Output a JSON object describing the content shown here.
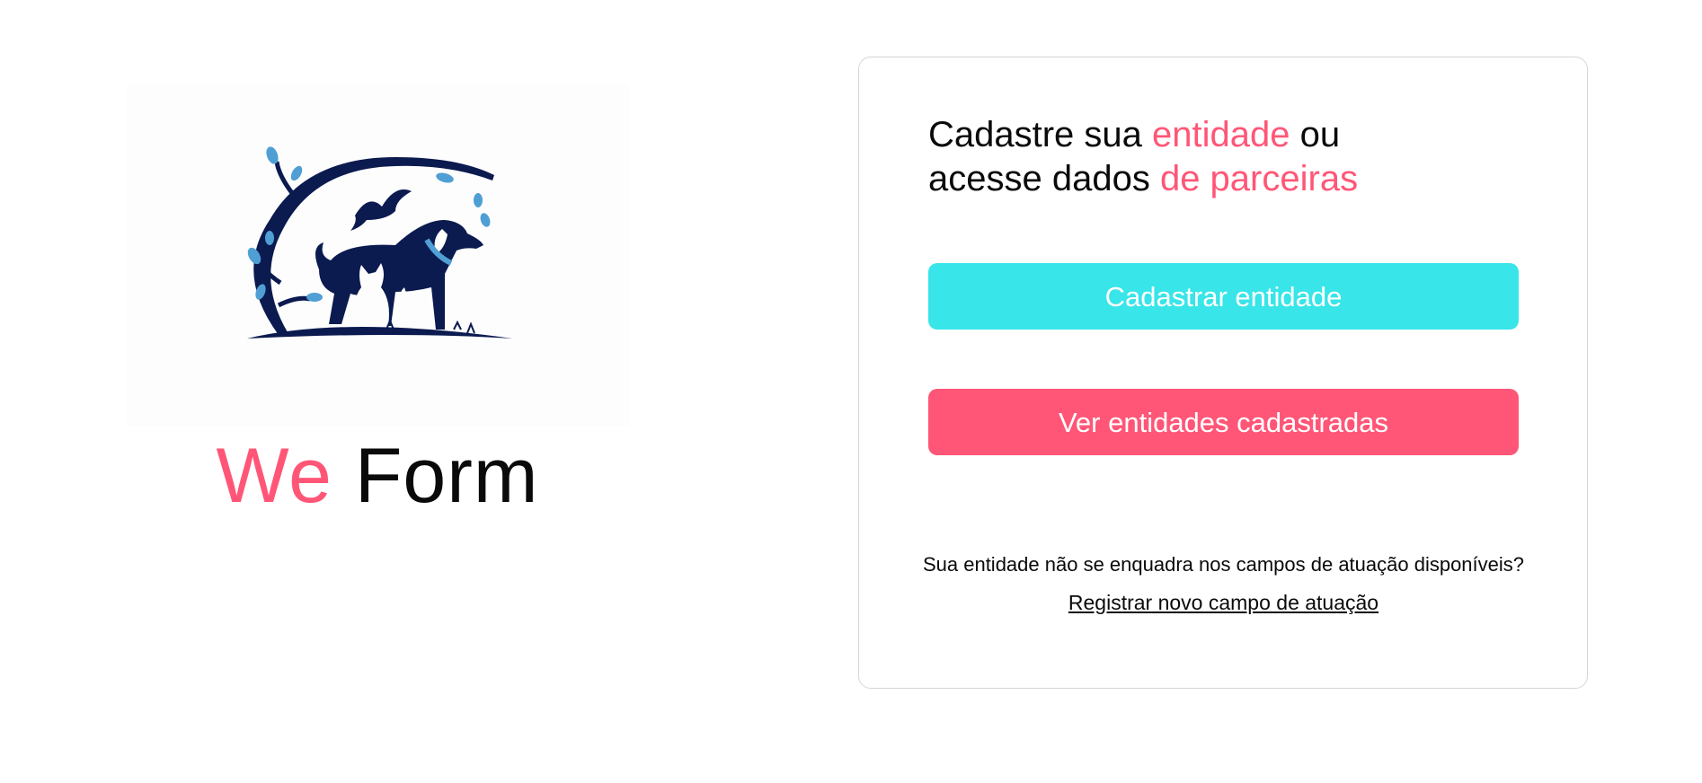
{
  "brand": {
    "name_we": "We",
    "name_form": "Form",
    "logo_icon": "pets-tree-logo-icon"
  },
  "colors": {
    "accent_pink": "#ff5677",
    "accent_cyan": "#38e5e8",
    "logo_navy": "#0b1a4f",
    "logo_leaf_blue": "#4f9fd4"
  },
  "card": {
    "headline_part1": "Cadastre sua ",
    "headline_accent1": "entidade",
    "headline_part2": " ou",
    "headline_part3": "acesse dados ",
    "headline_accent2": "de parceiras",
    "register_button": "Cadastrar entidade",
    "view_button": "Ver entidades cadastradas",
    "question": "Sua entidade não se enquadra nos campos de atuação disponíveis?",
    "register_field_link": "Registrar novo campo de atuação"
  }
}
